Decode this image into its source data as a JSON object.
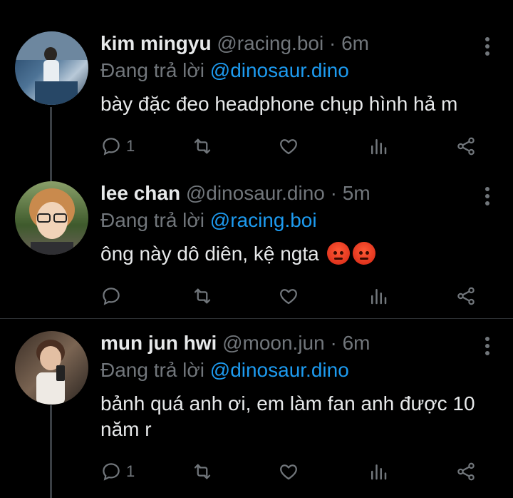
{
  "tweets": [
    {
      "name": "kim mingyu",
      "handle": "@racing.boi",
      "time": "· 6m",
      "replying_prefix": "Đang trả lời",
      "replying_to": "@dinosaur.dino",
      "text": "bày đặc đeo headphone chụp hình hả m",
      "reply_count": "1",
      "avatar_colors": [
        "#2b4a6b",
        "#9fb4c8"
      ]
    },
    {
      "name": "lee chan",
      "handle": "@dinosaur.dino",
      "time": "· 5m",
      "replying_prefix": "Đang trả lời",
      "replying_to": "@racing.boi",
      "text": "ông này dô diên, kệ ngta",
      "reply_count": "",
      "emoji": [
        "angry-face-emoji",
        "angry-face-emoji"
      ],
      "avatar_colors": [
        "#4d6e3a",
        "#d9b48a"
      ]
    },
    {
      "name": "mun jun hwi",
      "handle": "@moon.jun",
      "time": "· 6m",
      "replying_prefix": "Đang trả lời",
      "replying_to": "@dinosaur.dino",
      "text": "bảnh quá anh ơi, em làm fan anh được 10 năm r",
      "reply_count": "1",
      "avatar_colors": [
        "#5a4638",
        "#c9a58a"
      ]
    }
  ],
  "colors": {
    "accent": "#1d9bf0",
    "muted": "#71767b",
    "background": "#000000"
  }
}
